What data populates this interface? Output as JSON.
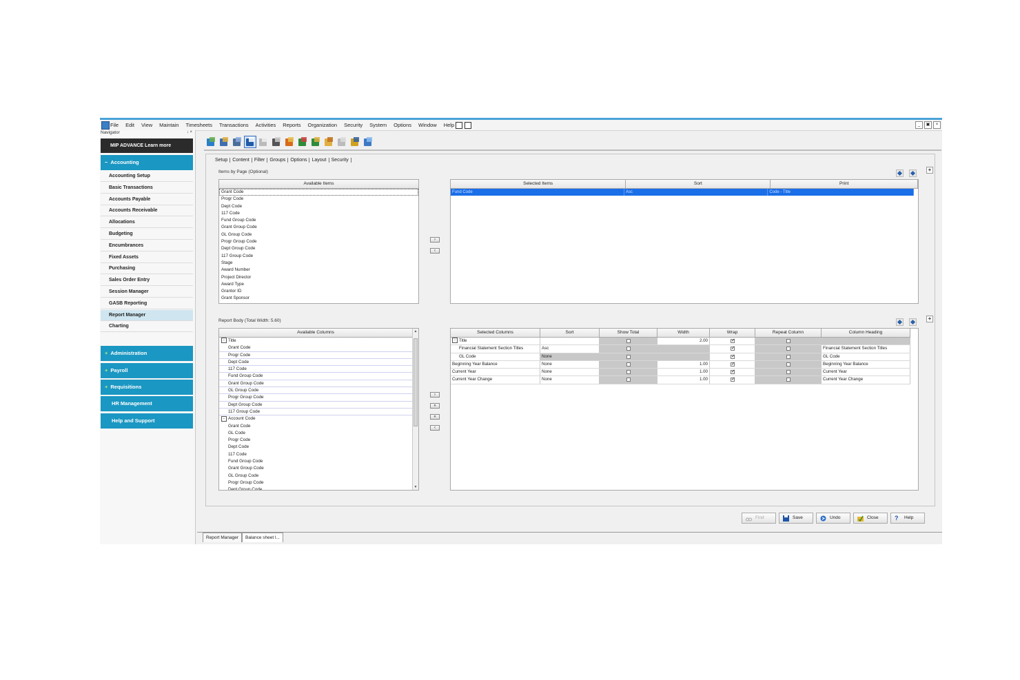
{
  "menubar": {
    "items": [
      "File",
      "Edit",
      "View",
      "Maintain",
      "Timesheets",
      "Transactions",
      "Activities",
      "Reports",
      "Organization",
      "Security",
      "System",
      "Options",
      "Window",
      "Help"
    ]
  },
  "navigator": {
    "label": "Navigator",
    "pin": "↓ ×",
    "banner": "MIP ADVANCE Learn more",
    "accounting_section": "Accounting",
    "items": [
      "Accounting Setup",
      "Basic Transactions",
      "Accounts Payable",
      "Accounts Receivable",
      "Allocations",
      "Budgeting",
      "Encumbrances",
      "Fixed Assets",
      "Purchasing",
      "Sales Order Entry",
      "Session Manager",
      "GASB Reporting",
      "Report Manager",
      "Charting"
    ],
    "sections": [
      "Administration",
      "Payroll",
      "Requisitions",
      "HR Management",
      "Help and Support"
    ]
  },
  "tabs": [
    "Setup",
    "Content",
    "Filter",
    "Groups",
    "Options",
    "Layout",
    "Security"
  ],
  "items_by_page": {
    "caption": "Items by Page (Optional)",
    "available_header": "Available Items",
    "available": [
      "Grant Code",
      "Progr Code",
      "Dept Code",
      "117 Code",
      "Fund Group Code",
      "Grant Group Code",
      "GL Group Code",
      "Progr Group Code",
      "Dept Group Code",
      "117 Group Code",
      "Stage",
      "Award Number",
      "Project Director",
      "Award Type",
      "Grantor ID",
      "Grant Sponsor"
    ],
    "selected_headers": [
      "Selected Items",
      "Sort",
      "Print"
    ],
    "selected_row": [
      "Fund Code",
      "Asc",
      "Code - Title"
    ]
  },
  "report_body": {
    "caption": "Report Body (Total Width: 5.60)",
    "available_header": "Available Columns",
    "tree": [
      {
        "label": "Title",
        "kind": "group"
      },
      {
        "label": "Grant Code",
        "kind": "child"
      },
      {
        "label": "Progr Code",
        "kind": "child"
      },
      {
        "label": "Dept Code",
        "kind": "child"
      },
      {
        "label": "117 Code",
        "kind": "child"
      },
      {
        "label": "Fund Group Code",
        "kind": "child"
      },
      {
        "label": "Grant Group Code",
        "kind": "child"
      },
      {
        "label": "GL Group Code",
        "kind": "child"
      },
      {
        "label": "Progr Group Code",
        "kind": "child"
      },
      {
        "label": "Dept Group Code",
        "kind": "child"
      },
      {
        "label": "117 Group Code",
        "kind": "child"
      },
      {
        "label": "Account Code",
        "kind": "group"
      },
      {
        "label": "Grant Code",
        "kind": "child2"
      },
      {
        "label": "GL Code",
        "kind": "child2"
      },
      {
        "label": "Progr Code",
        "kind": "child2"
      },
      {
        "label": "Dept Code",
        "kind": "child2"
      },
      {
        "label": "117 Code",
        "kind": "child2"
      },
      {
        "label": "Fund Group Code",
        "kind": "child2"
      },
      {
        "label": "Grant Group Code",
        "kind": "child2"
      },
      {
        "label": "GL Group Code",
        "kind": "child2"
      },
      {
        "label": "Progr Group Code",
        "kind": "child2"
      },
      {
        "label": "Dept Group Code",
        "kind": "child2"
      }
    ],
    "selected_headers": [
      "Selected Columns",
      "Sort",
      "Show Total",
      "Width",
      "Wrap",
      "Repeat Column",
      "Column Heading"
    ],
    "selected_rows": [
      {
        "col": "Title",
        "sort": "",
        "show_total": false,
        "width": "2.00",
        "wrap": true,
        "repeat": false,
        "heading": "",
        "group": true
      },
      {
        "col": "Financial Statement Section Titles",
        "sort": "Asc",
        "show_total": false,
        "width": "",
        "wrap": true,
        "repeat": false,
        "heading": "Financial Statement Section Titles",
        "indent": true
      },
      {
        "col": "GL Code",
        "sort": "None",
        "show_total": false,
        "width": "",
        "wrap": true,
        "repeat": false,
        "heading": "GL Code",
        "indent": true,
        "sort_gray": true
      },
      {
        "col": "Beginning Year Balance",
        "sort": "None",
        "show_total": false,
        "width": "1.00",
        "wrap": true,
        "repeat": false,
        "heading": "Beginning Year Balance"
      },
      {
        "col": "Current Year",
        "sort": "None",
        "show_total": false,
        "width": "1.00",
        "wrap": true,
        "repeat": false,
        "heading": "Current Year"
      },
      {
        "col": "Current Year Change",
        "sort": "None",
        "show_total": false,
        "width": "1.00",
        "wrap": true,
        "repeat": false,
        "heading": "Current Year Change"
      }
    ]
  },
  "arrows": {
    "right": "›",
    "left": "‹",
    "all_right": "»",
    "all_left": "«"
  },
  "buttons": {
    "find": "Find",
    "save": "Save",
    "undo": "Undo",
    "close": "Close",
    "help": "Help"
  },
  "doc_tabs": [
    "Report Manager",
    "Balance sheet l..."
  ],
  "colors": {
    "nav_section": "#1a97c2",
    "selection": "#1a6ee8",
    "banner": "#2b2b2b"
  }
}
